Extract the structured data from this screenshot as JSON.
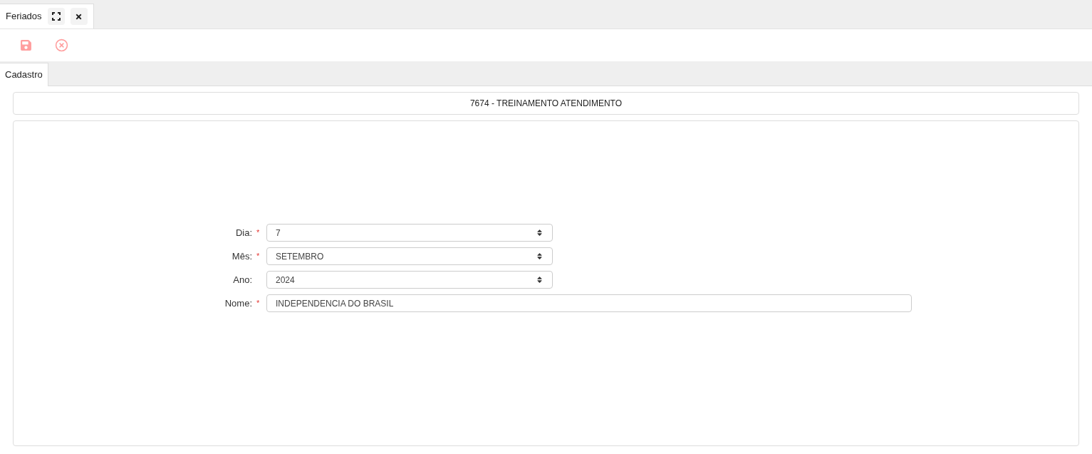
{
  "window_tabs": [
    {
      "label": "Feriados",
      "selected": true
    }
  ],
  "toolbar": {
    "save_disabled": true,
    "cancel_disabled": true
  },
  "tabs": [
    {
      "label": "Cadastro",
      "selected": true
    }
  ],
  "header": "7674 - TREINAMENTO ATENDIMENTO",
  "fields": [
    {
      "kind": "select",
      "label": "Dia:",
      "required_mark": "*",
      "value": "7"
    },
    {
      "kind": "select",
      "label": "Mês:",
      "required_mark": "*",
      "value": "SETEMBRO"
    },
    {
      "kind": "select",
      "label": "Ano:",
      "value": "2024"
    },
    {
      "kind": "text",
      "label": "Nome:",
      "required_mark": "*",
      "value": "INDEPENDENCIA DO BRASIL"
    }
  ]
}
